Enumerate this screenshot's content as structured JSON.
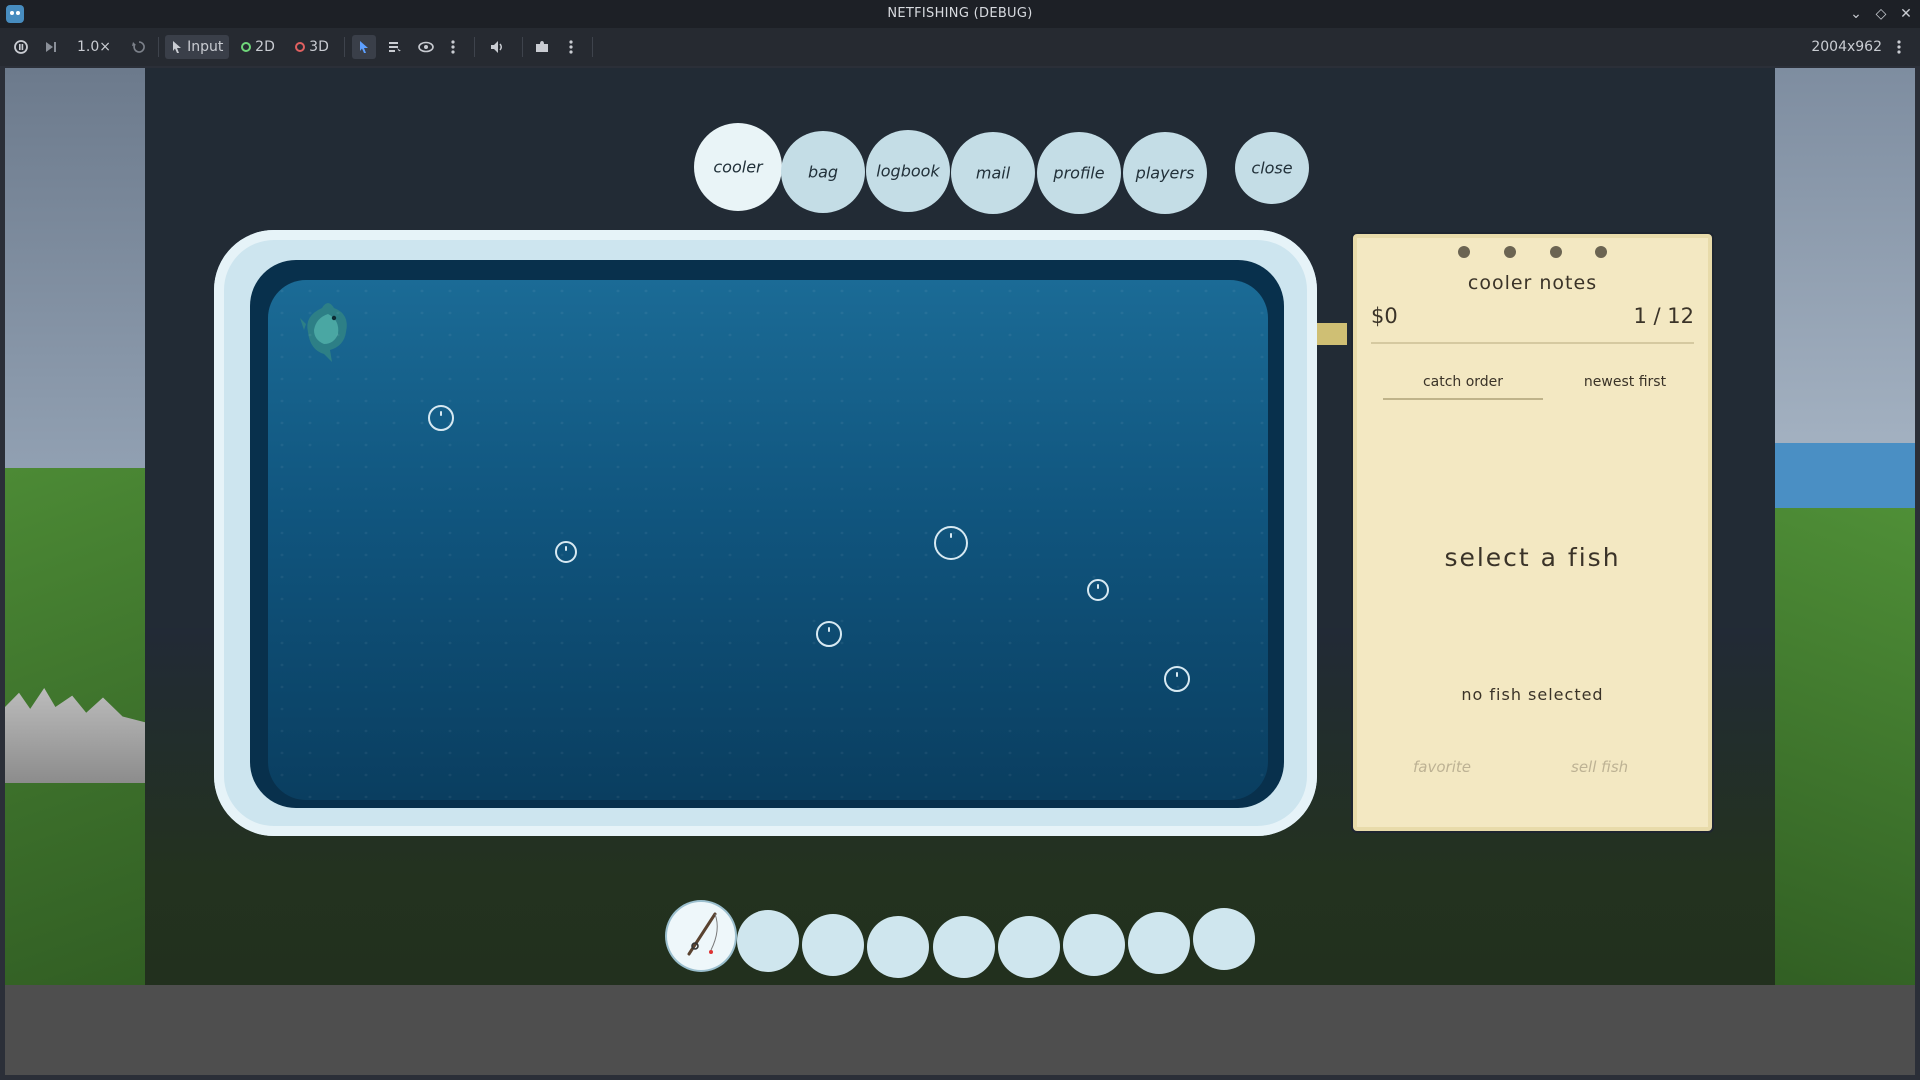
{
  "window": {
    "title": "NETFISHING (DEBUG)",
    "controls": [
      "chevron-down-icon",
      "maximize-icon",
      "close-icon"
    ]
  },
  "toolbar": {
    "speed": "1.0×",
    "input_label": "Input",
    "mode_2d": "2D",
    "mode_3d": "3D",
    "resolution": "2004x962",
    "colors": {
      "active_bg": "#3a3f49",
      "ring_2d": "#6fd67a",
      "ring_3d": "#e06060",
      "select_arrow": "#5ea0ff"
    }
  },
  "game": {
    "tabs": [
      {
        "label": "cooler",
        "active": true
      },
      {
        "label": "bag",
        "active": false
      },
      {
        "label": "logbook",
        "active": false
      },
      {
        "label": "mail",
        "active": false
      },
      {
        "label": "profile",
        "active": false
      },
      {
        "label": "players",
        "active": false
      }
    ],
    "close_label": "close",
    "notes": {
      "heading": "cooler notes",
      "money": "$0",
      "count": "1 / 12",
      "sort_options": [
        {
          "label": "catch order",
          "active": true
        },
        {
          "label": "newest first",
          "active": false
        }
      ],
      "placeholder": "select a fish",
      "status": "no fish selected",
      "favorite_label": "favorite",
      "sell_label": "sell fish"
    },
    "hotbar": {
      "slot_count": 9,
      "selected_slot": 1,
      "selected_item_icon": "fishing-rod-icon"
    },
    "colors": {
      "tank_frame": "#cde5ef",
      "water_top": "#1b6b96",
      "water_bottom": "#0a3e60",
      "notes_paper": "#f3e8c2",
      "tab_bg": "#c4dde6"
    }
  }
}
